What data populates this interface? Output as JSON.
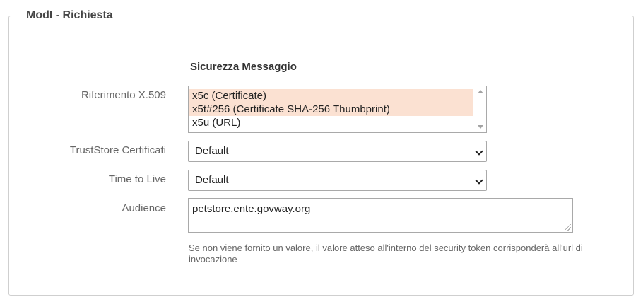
{
  "section": {
    "legend": "ModI - Richiesta",
    "title": "Sicurezza Messaggio"
  },
  "x509": {
    "label": "Riferimento X.509",
    "options": [
      {
        "text": "x5c (Certificate)",
        "selected": true
      },
      {
        "text": "x5t#256 (Certificate SHA-256 Thumbprint)",
        "selected": true
      },
      {
        "text": "x5u (URL)",
        "selected": false
      }
    ]
  },
  "truststore": {
    "label": "TrustStore Certificati",
    "value": "Default"
  },
  "ttl": {
    "label": "Time to Live",
    "value": "Default"
  },
  "audience": {
    "label": "Audience",
    "value": "petstore.ente.govway.org",
    "help": "Se non viene fornito un valore, il valore atteso all'interno del security token corrisponderà all'url di invocazione"
  },
  "icons": {
    "scroll_up": "triangle-up-icon",
    "scroll_down": "triangle-down-icon",
    "dropdown": "chevron-down-icon",
    "resize": "resize-grip-icon"
  },
  "colors": {
    "selected_option_bg": "#fbe1d2",
    "border": "#a9a9a9",
    "label_text": "#666666"
  }
}
